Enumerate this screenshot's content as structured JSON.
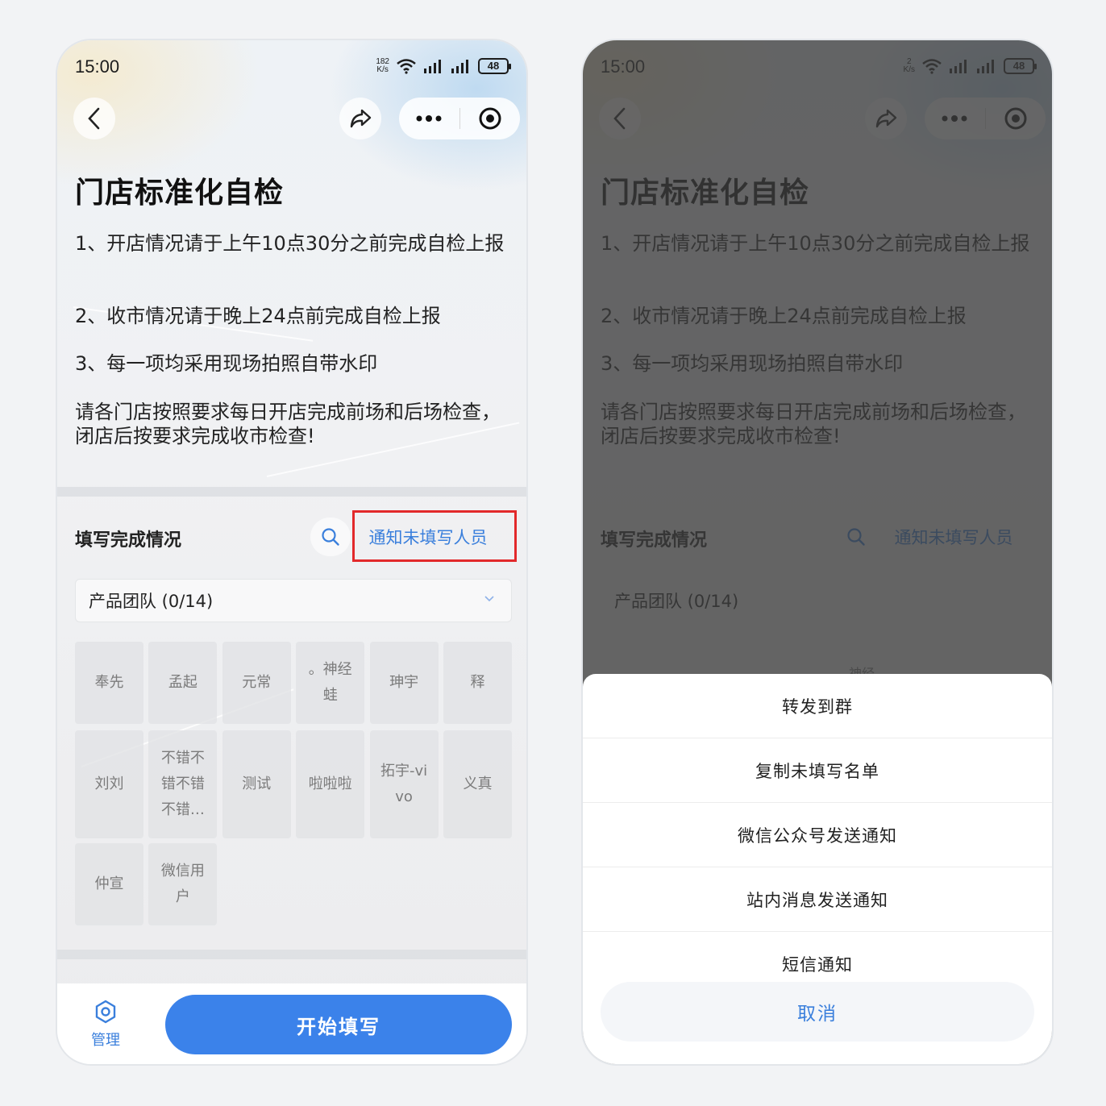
{
  "status_bar": {
    "time": "15:00",
    "netspeed_left": "182",
    "netspeed_right": "2",
    "netspeed_unit": "K/s",
    "battery": "48"
  },
  "page": {
    "title": "门店标准化自检",
    "rules": [
      "1、开店情况请于上午10点30分之前完成自检上报",
      "2、收市情况请于晚上24点前完成自检上报",
      "3、每一项均采用现场拍照自带水印",
      "请各门店按照要求每日开店完成前场和后场检查，闭店后按要求完成收市检查!"
    ]
  },
  "completion": {
    "section_title": "填写完成情况",
    "notify_label": "通知未填写人员",
    "team_select": "产品团队 (0/14)",
    "members": [
      "奉先",
      "孟起",
      "元常",
      "。神经蛙",
      "珅宇",
      "释",
      "刘刘",
      "不错不错不错不错…",
      "测试",
      "啦啦啦",
      "拓宇-vivo",
      "义真",
      "仲宣",
      "微信用户"
    ],
    "member_lines": {
      "3": [
        "。神经",
        "蛙"
      ],
      "7": [
        "不错不",
        "错不错",
        "不错…"
      ],
      "10": [
        "拓宇-vi",
        "vo"
      ],
      "13": [
        "微信用",
        "户"
      ]
    }
  },
  "bottom_bar": {
    "manage_label": "管理",
    "start_label": "开始填写"
  },
  "action_sheet": {
    "items": [
      "转发到群",
      "复制未填写名单",
      "微信公众号发送通知",
      "站内消息发送通知",
      "短信通知"
    ],
    "cancel_label": "取消",
    "peek_text": "神经"
  },
  "colors": {
    "accent": "#3b82ea",
    "link": "#3a7fdc",
    "highlight": "#e2292b"
  }
}
